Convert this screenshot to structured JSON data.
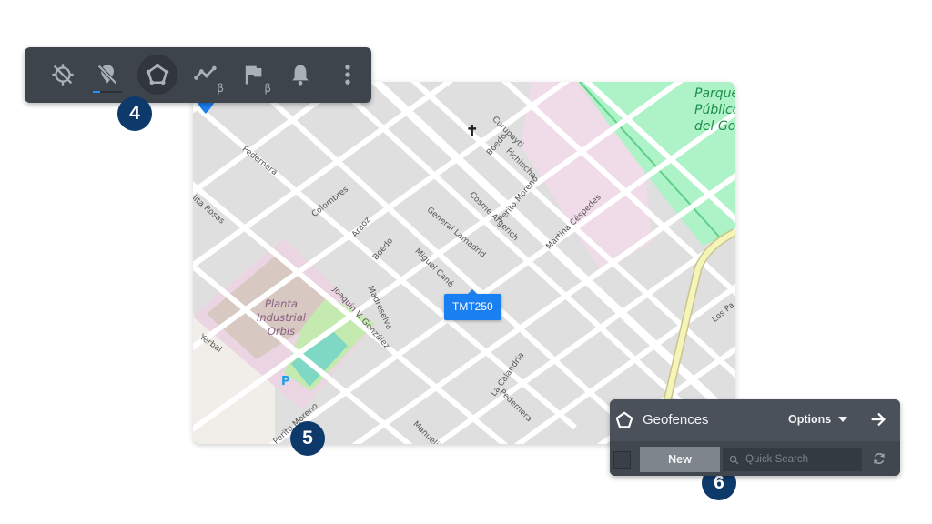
{
  "toolbar": {
    "items": [
      {
        "id": "gps-off",
        "icon": "gps-off-icon",
        "label": ""
      },
      {
        "id": "location-off",
        "icon": "location-off-icon",
        "label": ""
      },
      {
        "id": "geofences",
        "icon": "pentagon-icon",
        "label": "",
        "active": true
      },
      {
        "id": "routes",
        "icon": "route-icon",
        "label": "",
        "beta": "β"
      },
      {
        "id": "pois",
        "icon": "flag-icon",
        "label": "",
        "beta": "β"
      },
      {
        "id": "alerts",
        "icon": "bell-icon",
        "label": ""
      },
      {
        "id": "more",
        "icon": "more-vert-icon",
        "label": ""
      }
    ],
    "accent_color": "#1e90ff"
  },
  "callouts": {
    "toolbar": "4",
    "map": "5",
    "panel": "6"
  },
  "map": {
    "device_label": "TMT250",
    "park_label": [
      "Parque",
      "Público",
      "del Gol"
    ],
    "plant_label": [
      "Planta",
      "Industrial",
      "Orbis"
    ],
    "parking_symbol": "P",
    "cross_symbol": "✝",
    "streets": [
      "Pedernera",
      "Colombres",
      "Araoz",
      "Boedo",
      "Curupayti",
      "Pichincha",
      "Cosme Argerich",
      "Perito Moreno",
      "Martina Céspedes",
      "General Lamadrid",
      "Miguel Cané",
      "Madreselva",
      "Joaquín V. González",
      "Yerbal",
      "La Calandria",
      "Pedernera",
      "Manuelita",
      "Los Pa",
      "Perito Moreno",
      "lita Rosas"
    ],
    "marker_color": "#1a7ff0"
  },
  "panel": {
    "title": "Geofences",
    "options_label": "Options",
    "new_label": "New",
    "search_placeholder": "Quick Search",
    "search_value": ""
  }
}
